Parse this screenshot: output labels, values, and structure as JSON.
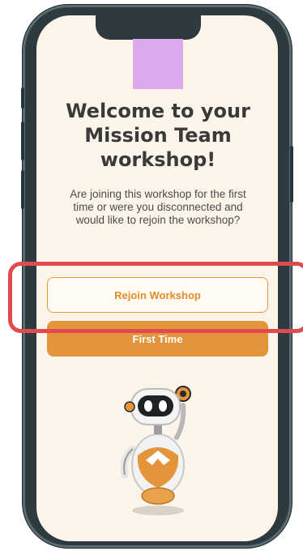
{
  "welcome": {
    "title_line1": "Welcome to your",
    "title_line2": "Mission Team",
    "title_line3": "workshop!",
    "subtitle": "Are joining this workshop for the first time or were you disconnected and would like to rejoin the workshop?"
  },
  "buttons": {
    "rejoin_label": "Rejoin Workshop",
    "first_time_label": "First Time"
  },
  "colors": {
    "screen_bg": "#fdf5ea",
    "accent_orange": "#e4943a",
    "logo_placeholder": "#dca9ec",
    "highlight_red": "#e04b4f",
    "frame": "#2d3b40"
  },
  "icons": {
    "logo": "logo-placeholder",
    "mascot": "robot-mascot-illustration"
  }
}
